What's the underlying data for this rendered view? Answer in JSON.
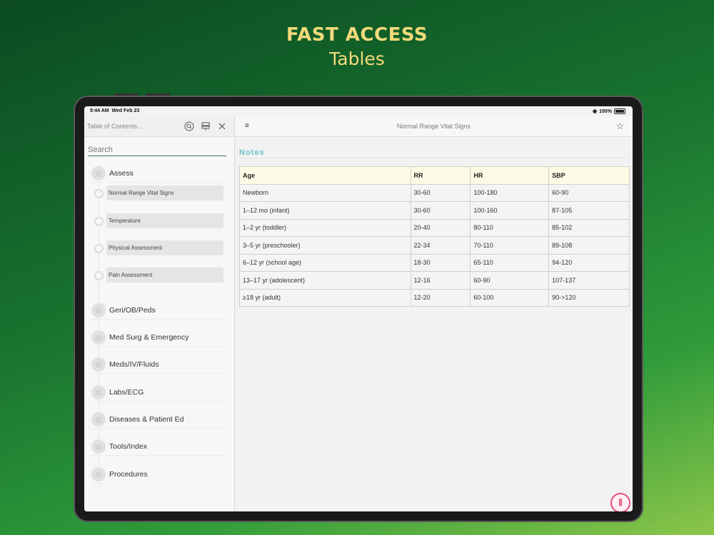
{
  "promo": {
    "line1": "FAST ACCESS",
    "line2": "Tables"
  },
  "status_bar": {
    "time": "9:44 AM",
    "date": "Wed Feb 23",
    "battery": "100%"
  },
  "sidebar": {
    "placeholder_toc": "Table of Contents...",
    "search_placeholder": "Search",
    "icons": [
      "search-icon",
      "signpost-icon",
      "close-icon"
    ],
    "categories": [
      {
        "label": "Assess",
        "expanded": true,
        "children": [
          "Normal Range Vital Signs",
          "Temperature",
          "Physical Assessment",
          "Pain Assessment"
        ]
      },
      {
        "label": "Geri/OB/Peds"
      },
      {
        "label": "Med Surg & Emergency"
      },
      {
        "label": "Meds/IV/Fluids"
      },
      {
        "label": "Labs/ECG"
      },
      {
        "label": "Diseases & Patient Ed"
      },
      {
        "label": "Tools/Index"
      },
      {
        "label": "Procedures"
      }
    ]
  },
  "main": {
    "title": "Normal Range Vital Signs",
    "notes_label": "Notes",
    "table": {
      "headers": [
        "Age",
        "RR",
        "HR",
        "SBP"
      ],
      "rows": [
        [
          "Newborn",
          "30-60",
          "100-180",
          "60-90"
        ],
        [
          "1–12 mo (infant)",
          "30-60",
          "100-160",
          "87-105"
        ],
        [
          "1–2 yr (toddler)",
          "20-40",
          "80-110",
          "85-102"
        ],
        [
          "3–5 yr (preschooler)",
          "22-34",
          "70-110",
          "89-108"
        ],
        [
          "6–12 yr (school age)",
          "18-30",
          "65-110",
          "94-120"
        ],
        [
          "13–17 yr (adolescent)",
          "12-16",
          "60-90",
          "107-137"
        ],
        [
          "≥18 yr (adult)",
          "12-20",
          "60-100",
          "90->120"
        ]
      ]
    }
  },
  "colors": {
    "notes_accent": "#6cc2cc",
    "promo_text": "#f1d97a",
    "fab_accent": "#e0507a"
  }
}
